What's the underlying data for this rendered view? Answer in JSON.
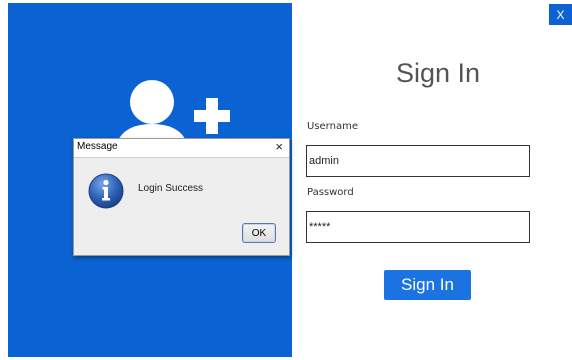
{
  "window": {
    "close_label": "X"
  },
  "login": {
    "title": "Sign In",
    "username_label": "Username",
    "username_value": "admin",
    "password_label": "Password",
    "password_value": "*****",
    "signin_button": "Sign In"
  },
  "dialog": {
    "title": "Message",
    "close_label": "×",
    "message": "Login Success",
    "ok_label": "OK"
  },
  "icons": {
    "brand": "user-add-icon",
    "info": "info-icon"
  },
  "colors": {
    "panel_blue": "#0b62d2",
    "button_blue": "#1a73e0"
  }
}
